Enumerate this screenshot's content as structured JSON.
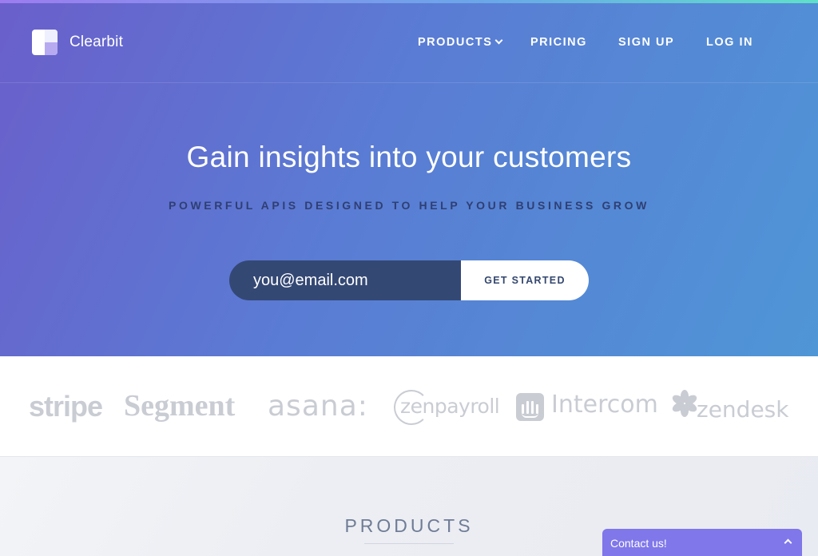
{
  "brand": {
    "name": "Clearbit"
  },
  "nav": {
    "items": [
      {
        "label": "PRODUCTS",
        "has_dropdown": true
      },
      {
        "label": "PRICING"
      },
      {
        "label": "SIGN UP"
      },
      {
        "label": "LOG IN"
      }
    ]
  },
  "hero": {
    "title": "Gain insights into your customers",
    "subtitle": "POWERFUL APIS DESIGNED TO HELP YOUR BUSINESS GROW",
    "email_placeholder": "you@email.com",
    "cta_label": "GET STARTED"
  },
  "customers": {
    "logos": [
      "stripe",
      "Segment",
      "asana:",
      "zenpayroll",
      "Intercom",
      "zendesk"
    ]
  },
  "products": {
    "heading": "PRODUCTS"
  },
  "chat": {
    "label": "Contact us!"
  },
  "colors": {
    "hero_gradient_start": "#6a5fcb",
    "hero_gradient_end": "#4f96d6",
    "input_bg": "#344874",
    "chat_bg": "#7f77ea",
    "logo_gray": "#c9ccd3"
  }
}
